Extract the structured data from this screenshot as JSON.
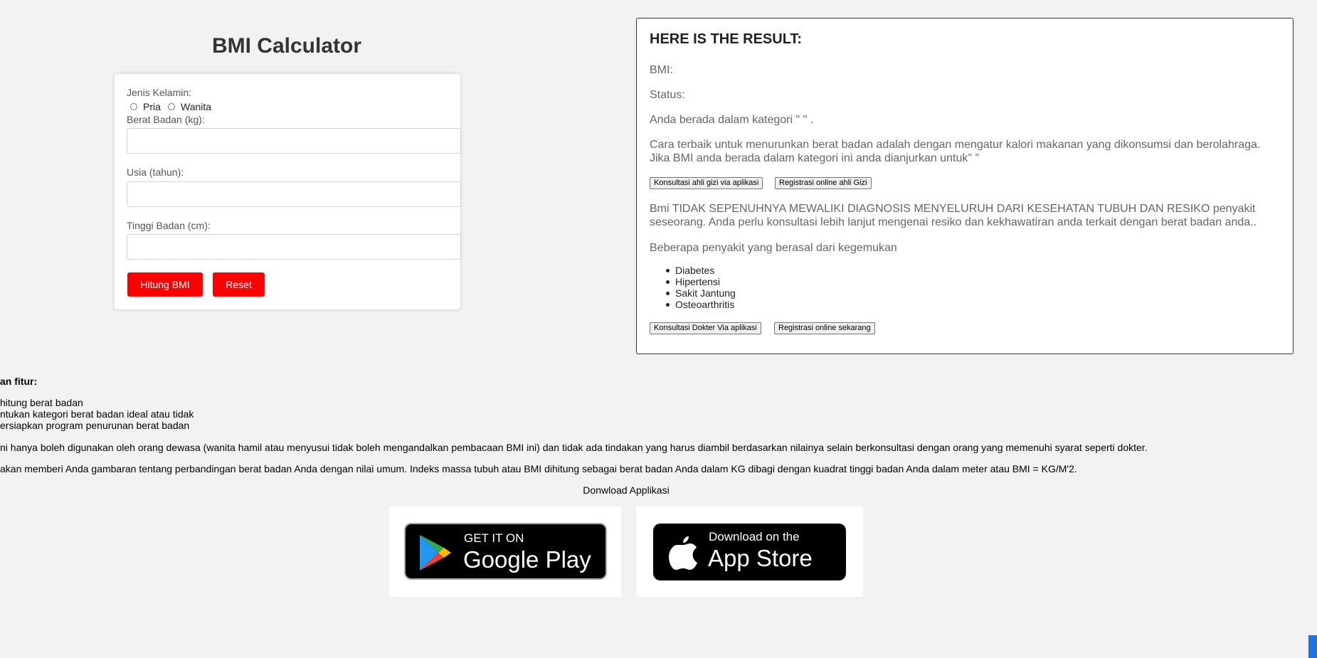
{
  "calculator": {
    "title": "BMI Calculator",
    "gender_label": "Jenis Kelamin:",
    "gender_options": [
      "Pria",
      "Wanita"
    ],
    "weight_label": "Berat Badan (kg):",
    "age_label": "Usia (tahun):",
    "height_label": "Tinggi Badan (cm):",
    "calculate_button": "Hitung BMI",
    "reset_button": "Reset"
  },
  "result": {
    "heading": "HERE IS THE RESULT:",
    "bmi_label": "BMI:",
    "status_label": "Status:",
    "category_text": "Anda berada dalam kategori \" \" .",
    "advice_line1": "Cara terbaik untuk menurunkan berat badan adalah dengan mengatur kalori makanan yang dikonsumsi dan berolahraga.",
    "advice_line2": "Jika BMI anda berada dalam kategori ini anda dianjurkan untuk\" \"",
    "button_nutrition_app": "Konsultasi ahli gizi via aplikasi",
    "button_nutrition_online": "Registrasi online ahli Gizi",
    "disclaimer_line1": "Bmi TIDAK SEPENUHNYA MEWALIKI DIAGNOSIS MENYELURUH DARI KESEHATAN TUBUH DAN RESIKO penyakit",
    "disclaimer_line2": "seseorang. Anda perlu konsultasi lebih lanjut mengenai resiko dan kekhawatiran anda terkait dengan berat badan anda..",
    "diseases_heading": "Beberapa penyakit yang berasal dari kegemukan",
    "diseases": [
      "Diabetes",
      "Hipertensi",
      "Sakit Jantung",
      "Osteoarthritis"
    ],
    "button_doctor_app": "Konsultasi Dokter Via aplikasi",
    "button_doctor_online": "Registrasi online sekarang"
  },
  "features": {
    "heading": "an fitur:",
    "items": [
      "hitung berat badan",
      "ntukan kategori berat badan ideal atau tidak",
      "ersiapkan program penurunan berat badan"
    ],
    "note1": "ni hanya boleh digunakan oleh orang dewasa (wanita hamil atau menyusui tidak boleh mengandalkan pembacaan BMI ini) dan tidak ada tindakan yang harus diambil berdasarkan nilainya selain berkonsultasi dengan orang yang memenuhi syarat seperti dokter.",
    "note2": "akan memberi Anda gambaran tentang perbandingan berat badan Anda dengan nilai umum. Indeks massa tubuh atau BMI dihitung sebagai berat badan Anda dalam KG dibagi dengan kuadrat tinggi badan Anda dalam meter atau BMI = KG/M'2."
  },
  "download": {
    "heading": "Donwload Applikasi",
    "google_small": "GET IT ON",
    "google_big": "Google Play",
    "apple_small": "Download on the",
    "apple_big": "App Store"
  },
  "colors": {
    "accent_red": "#ff0000",
    "page_bg": "#f2f2f2"
  }
}
